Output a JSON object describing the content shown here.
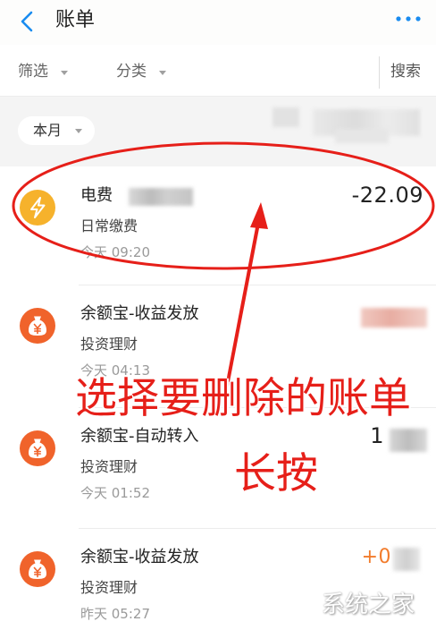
{
  "header": {
    "title": "账单",
    "back_icon": "chevron-left-icon",
    "more_icon": "more-dots-icon"
  },
  "filters": {
    "filter_label": "筛选",
    "category_label": "分类",
    "search_label": "搜索"
  },
  "month": {
    "label": "本月"
  },
  "items": [
    {
      "title": "电费",
      "subtitle": "日常缴费",
      "time": "今天 09:20",
      "amount": "-22.09",
      "amount_color": "#222222",
      "icon": "lightning-icon",
      "icon_color": "#f6b22c"
    },
    {
      "title": "余额宝-收益发放",
      "subtitle": "投资理财",
      "time": "今天 04:13",
      "icon": "money-bag-icon",
      "icon_color": "#f0632b"
    },
    {
      "title": "余额宝-自动转入",
      "subtitle": "投资理财",
      "time": "今天 01:52",
      "amount": "1",
      "amount_color": "#222222",
      "icon": "money-bag-icon",
      "icon_color": "#f0632b"
    },
    {
      "title": "余额宝-收益发放",
      "subtitle": "投资理财",
      "time": "昨天 05:27",
      "amount": "+0",
      "amount_color": "#f27c2c",
      "icon": "money-bag-icon",
      "icon_color": "#f0632b"
    }
  ],
  "annotation": {
    "line1": "选择要删除的账单",
    "line2": "长按",
    "color": "#e61f19"
  },
  "watermark": {
    "text": "系统之家"
  },
  "colors": {
    "accent": "#1a8cf0",
    "income": "#f27c2c",
    "background": "#f4f4f4"
  }
}
